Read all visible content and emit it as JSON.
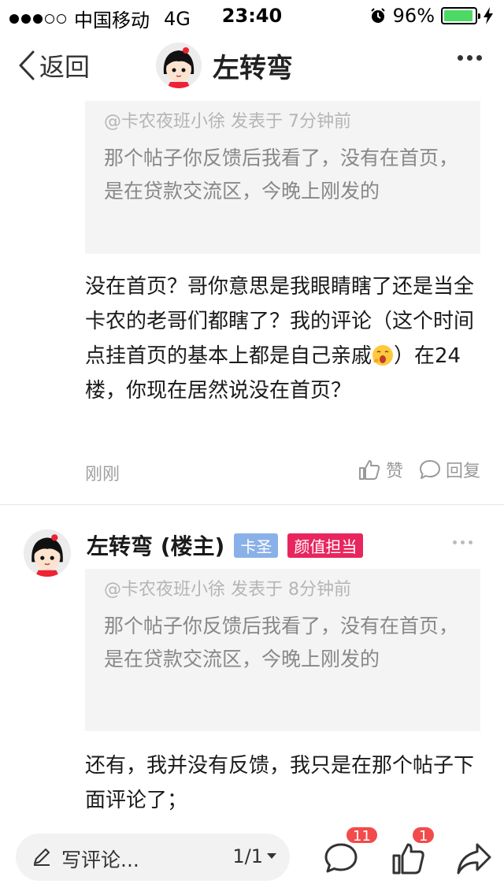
{
  "status_bar": {
    "carrier": "中国移动",
    "network": "4G",
    "time": "23:40",
    "battery_percent": "96%",
    "battery_level": 0.96,
    "battery_color": "#4cd964",
    "icons": [
      "signal-dots-icon",
      "alarm-icon",
      "battery-icon",
      "charging-bolt-icon"
    ]
  },
  "nav": {
    "back_label": "返回",
    "title": "左转弯",
    "icons": [
      "back-chevron-icon",
      "more-dots-icon"
    ]
  },
  "reply1": {
    "quote_meta": "@卡农夜班小徐 发表于 7分钟前",
    "quote_text": "那个帖子你反馈后我看了，没有在首页，是在贷款交流区，今晚上刚发的",
    "body_part1": "没在首页？哥你意思是我眼睛瞎了还是当全卡农的老哥们都瞎了？我的评论（这个时间点挂首页的基本上都是自己亲戚",
    "body_part2": "）在24楼，你现在居然说没在首页？",
    "emoji": "yawn-emoji-icon",
    "time": "刚刚",
    "like_label": "赞",
    "reply_label": "回复"
  },
  "post2": {
    "author": "左转弯 (楼主)",
    "badge1": "卡圣",
    "badge2": "颜值担当",
    "badge1_color": "#8ab0e8",
    "badge2_color": "#e8265e",
    "quote_meta": "@卡农夜班小徐 发表于 8分钟前",
    "quote_text": "那个帖子你反馈后我看了，没有在首页，是在贷款交流区，今晚上刚发的",
    "body": "还有，我并没有反馈，我只是在那个帖子下面评论了；"
  },
  "bottom_bar": {
    "comment_placeholder": "写评论...",
    "page_indicator": "1/1",
    "comment_count": "11",
    "like_count": "1",
    "badge_color": "#f24b4b",
    "icons": [
      "pen-icon",
      "comment-bubble-icon",
      "thumbs-up-icon",
      "share-arrow-icon"
    ]
  }
}
